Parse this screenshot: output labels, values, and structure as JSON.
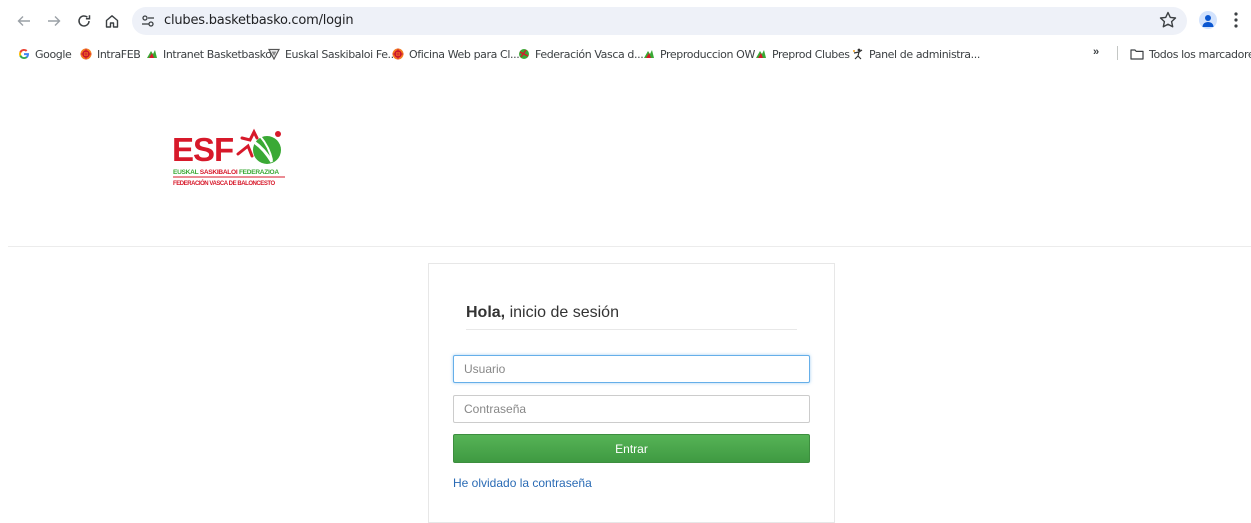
{
  "browser": {
    "url": "clubes.basketbasko.com/login",
    "bookmarks": [
      {
        "label": "Google",
        "icon": "google-icon"
      },
      {
        "label": "IntraFEB",
        "icon": "intrafeb-icon"
      },
      {
        "label": "Intranet Basketbasko",
        "icon": "basketbasko-icon"
      },
      {
        "label": "Euskal Saskibaloi Fe...",
        "icon": "shield-icon"
      },
      {
        "label": "Oficina Web para Cl...",
        "icon": "intrafeb-icon"
      },
      {
        "label": "Federación Vasca d...",
        "icon": "federation-icon"
      },
      {
        "label": "Preproduccion OW",
        "icon": "basketbasko-icon"
      },
      {
        "label": "Preprod Clubes",
        "icon": "basketbasko-icon"
      },
      {
        "label": "Panel de administra...",
        "icon": "player-icon"
      }
    ],
    "overflow_label": "»",
    "all_bookmarks_label": "Todos los marcadores"
  },
  "logo": {
    "text": "ESF",
    "line1_a": "EUSKAL ",
    "line1_b": "SASKIBALOI",
    "line1_c": " FEDERAZIOA",
    "line2": "FEDERACIÓN VASCA DE BALONCESTO",
    "colors": {
      "red": "#d7192a",
      "green": "#3aa935"
    }
  },
  "login": {
    "title_bold": "Hola,",
    "title_rest": " inicio de sesión",
    "username_placeholder": "Usuario",
    "password_placeholder": "Contraseña",
    "submit_label": "Entrar",
    "forgot_label": "He olvidado la contraseña"
  },
  "colors": {
    "submit": "#4ca54e",
    "link": "#2a6bb5",
    "focus": "#66afe9"
  }
}
